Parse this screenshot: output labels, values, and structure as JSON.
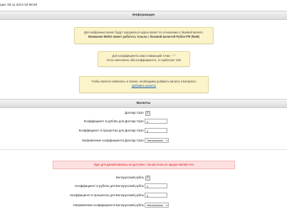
{
  "header": {
    "updated_text": "ции: 09.11.2024 02:58:50"
  },
  "sections": {
    "info": "Информация",
    "currencies": "Валюты"
  },
  "notices": {
    "moex_line1": "Для выбранных валют будут загружаться курсы валют по отношению к базовой валюте.",
    "moex_line2": "Внимание МОЕХ может работать только с базовой валютой Рубли РФ (RUB)",
    "coef_line1": "Для коэффициента знак плавающей точки - \".\"",
    "coef_line2": "Если заполнены оба коэффициента, то сработает оба",
    "add_line1": "Чтобы валюта появилась в списке, необходимо добавить валюту в Битрикса.",
    "add_link": "Добавить валюты",
    "unavailable": "Курс для данной валюты не доступен, так как moex не предоставляет его"
  },
  "usd": {
    "name_label": "Доллар США",
    "checked": true,
    "coef_rub_label": "Коэффициент в рублях для Доллар США",
    "coef_rub_value": "0",
    "coef_pct_label": "Коэффициент в процентах для Доллар США",
    "coef_pct_value": "0",
    "direction_label": "Направление коэффициента Доллар США",
    "direction_value": "Увеличивать"
  },
  "byn": {
    "name_label": "Белорусский рубль",
    "checked": true,
    "coef_rub_label": "Коэффициент в рублях для Белорусский рубль",
    "coef_rub_value": "0",
    "coef_pct_label": "Коэффициент в процентах для Белорусский рубль",
    "coef_pct_value": "0",
    "direction_label": "Направление коэффициента Белорусский рубль",
    "direction_value": "Увеличивать"
  }
}
